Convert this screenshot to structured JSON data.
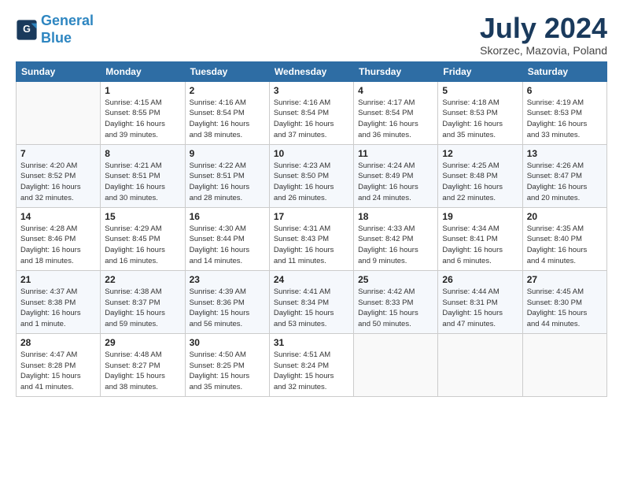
{
  "header": {
    "logo_line1": "General",
    "logo_line2": "Blue",
    "month_year": "July 2024",
    "location": "Skorzec, Mazovia, Poland"
  },
  "days_of_week": [
    "Sunday",
    "Monday",
    "Tuesday",
    "Wednesday",
    "Thursday",
    "Friday",
    "Saturday"
  ],
  "weeks": [
    [
      {
        "num": "",
        "info": ""
      },
      {
        "num": "1",
        "info": "Sunrise: 4:15 AM\nSunset: 8:55 PM\nDaylight: 16 hours\nand 39 minutes."
      },
      {
        "num": "2",
        "info": "Sunrise: 4:16 AM\nSunset: 8:54 PM\nDaylight: 16 hours\nand 38 minutes."
      },
      {
        "num": "3",
        "info": "Sunrise: 4:16 AM\nSunset: 8:54 PM\nDaylight: 16 hours\nand 37 minutes."
      },
      {
        "num": "4",
        "info": "Sunrise: 4:17 AM\nSunset: 8:54 PM\nDaylight: 16 hours\nand 36 minutes."
      },
      {
        "num": "5",
        "info": "Sunrise: 4:18 AM\nSunset: 8:53 PM\nDaylight: 16 hours\nand 35 minutes."
      },
      {
        "num": "6",
        "info": "Sunrise: 4:19 AM\nSunset: 8:53 PM\nDaylight: 16 hours\nand 33 minutes."
      }
    ],
    [
      {
        "num": "7",
        "info": "Sunrise: 4:20 AM\nSunset: 8:52 PM\nDaylight: 16 hours\nand 32 minutes."
      },
      {
        "num": "8",
        "info": "Sunrise: 4:21 AM\nSunset: 8:51 PM\nDaylight: 16 hours\nand 30 minutes."
      },
      {
        "num": "9",
        "info": "Sunrise: 4:22 AM\nSunset: 8:51 PM\nDaylight: 16 hours\nand 28 minutes."
      },
      {
        "num": "10",
        "info": "Sunrise: 4:23 AM\nSunset: 8:50 PM\nDaylight: 16 hours\nand 26 minutes."
      },
      {
        "num": "11",
        "info": "Sunrise: 4:24 AM\nSunset: 8:49 PM\nDaylight: 16 hours\nand 24 minutes."
      },
      {
        "num": "12",
        "info": "Sunrise: 4:25 AM\nSunset: 8:48 PM\nDaylight: 16 hours\nand 22 minutes."
      },
      {
        "num": "13",
        "info": "Sunrise: 4:26 AM\nSunset: 8:47 PM\nDaylight: 16 hours\nand 20 minutes."
      }
    ],
    [
      {
        "num": "14",
        "info": "Sunrise: 4:28 AM\nSunset: 8:46 PM\nDaylight: 16 hours\nand 18 minutes."
      },
      {
        "num": "15",
        "info": "Sunrise: 4:29 AM\nSunset: 8:45 PM\nDaylight: 16 hours\nand 16 minutes."
      },
      {
        "num": "16",
        "info": "Sunrise: 4:30 AM\nSunset: 8:44 PM\nDaylight: 16 hours\nand 14 minutes."
      },
      {
        "num": "17",
        "info": "Sunrise: 4:31 AM\nSunset: 8:43 PM\nDaylight: 16 hours\nand 11 minutes."
      },
      {
        "num": "18",
        "info": "Sunrise: 4:33 AM\nSunset: 8:42 PM\nDaylight: 16 hours\nand 9 minutes."
      },
      {
        "num": "19",
        "info": "Sunrise: 4:34 AM\nSunset: 8:41 PM\nDaylight: 16 hours\nand 6 minutes."
      },
      {
        "num": "20",
        "info": "Sunrise: 4:35 AM\nSunset: 8:40 PM\nDaylight: 16 hours\nand 4 minutes."
      }
    ],
    [
      {
        "num": "21",
        "info": "Sunrise: 4:37 AM\nSunset: 8:38 PM\nDaylight: 16 hours\nand 1 minute."
      },
      {
        "num": "22",
        "info": "Sunrise: 4:38 AM\nSunset: 8:37 PM\nDaylight: 15 hours\nand 59 minutes."
      },
      {
        "num": "23",
        "info": "Sunrise: 4:39 AM\nSunset: 8:36 PM\nDaylight: 15 hours\nand 56 minutes."
      },
      {
        "num": "24",
        "info": "Sunrise: 4:41 AM\nSunset: 8:34 PM\nDaylight: 15 hours\nand 53 minutes."
      },
      {
        "num": "25",
        "info": "Sunrise: 4:42 AM\nSunset: 8:33 PM\nDaylight: 15 hours\nand 50 minutes."
      },
      {
        "num": "26",
        "info": "Sunrise: 4:44 AM\nSunset: 8:31 PM\nDaylight: 15 hours\nand 47 minutes."
      },
      {
        "num": "27",
        "info": "Sunrise: 4:45 AM\nSunset: 8:30 PM\nDaylight: 15 hours\nand 44 minutes."
      }
    ],
    [
      {
        "num": "28",
        "info": "Sunrise: 4:47 AM\nSunset: 8:28 PM\nDaylight: 15 hours\nand 41 minutes."
      },
      {
        "num": "29",
        "info": "Sunrise: 4:48 AM\nSunset: 8:27 PM\nDaylight: 15 hours\nand 38 minutes."
      },
      {
        "num": "30",
        "info": "Sunrise: 4:50 AM\nSunset: 8:25 PM\nDaylight: 15 hours\nand 35 minutes."
      },
      {
        "num": "31",
        "info": "Sunrise: 4:51 AM\nSunset: 8:24 PM\nDaylight: 15 hours\nand 32 minutes."
      },
      {
        "num": "",
        "info": ""
      },
      {
        "num": "",
        "info": ""
      },
      {
        "num": "",
        "info": ""
      }
    ]
  ]
}
